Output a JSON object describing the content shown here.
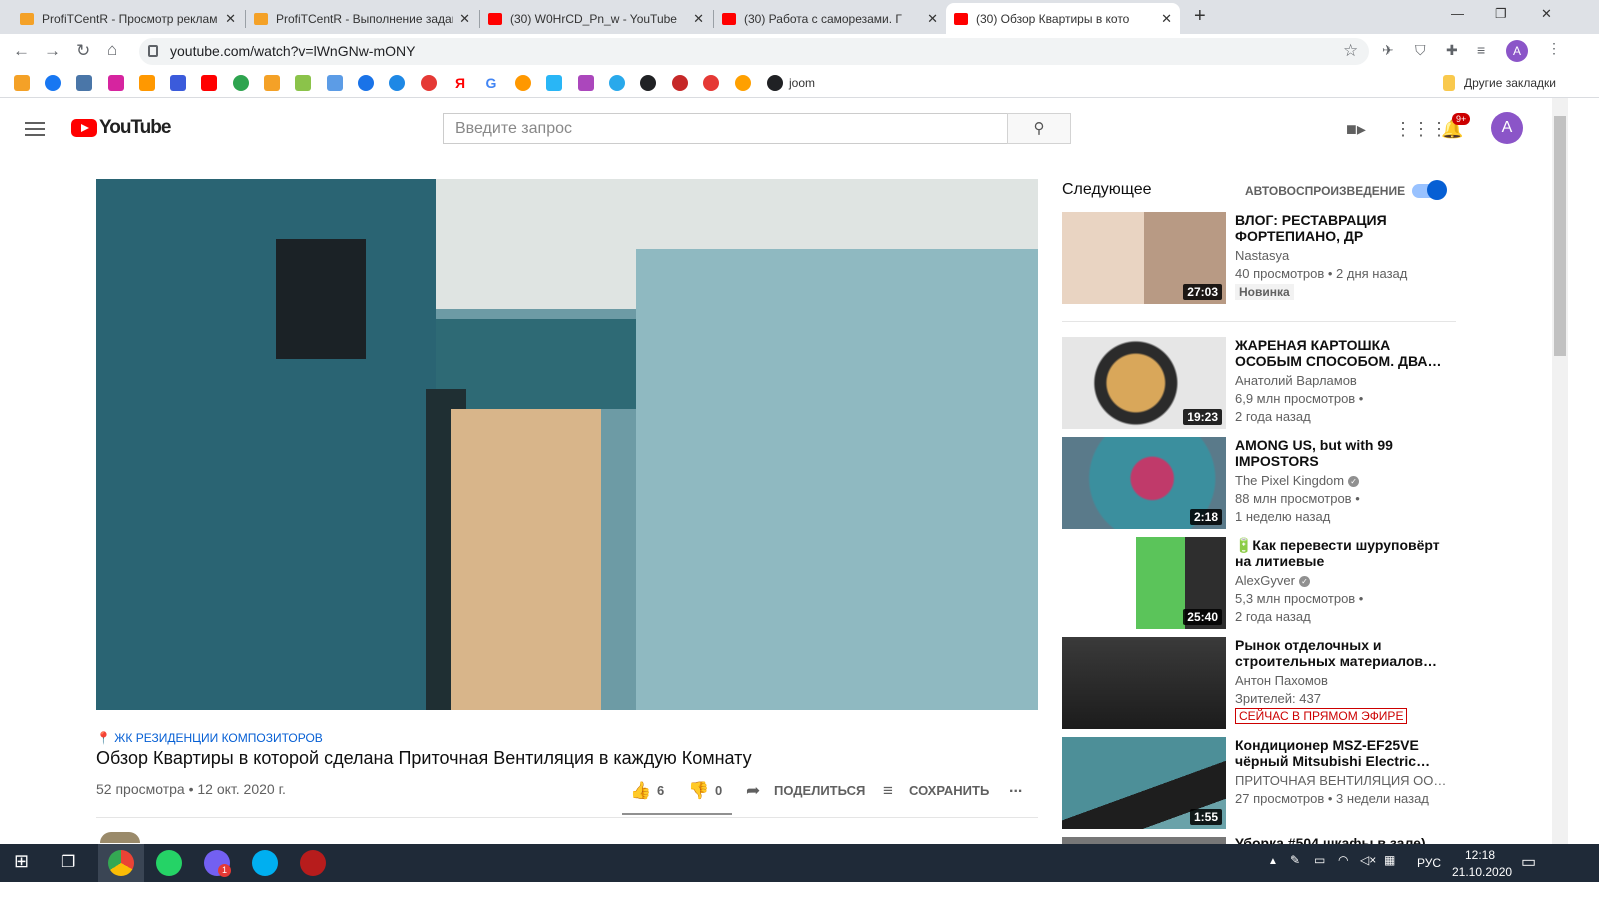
{
  "browser": {
    "tabs": [
      {
        "title": "ProfiTCentR - Просмотр реклам",
        "favicon_color": "#f4a127"
      },
      {
        "title": "ProfiTCentR - Выполнение задан",
        "favicon_color": "#f4a127"
      },
      {
        "title": "(30) W0HrCD_Pn_w - YouTube",
        "favicon_color": "#ff0000"
      },
      {
        "title": "(30) Работа с саморезами. Г",
        "favicon_color": "#ff0000"
      },
      {
        "title": "(30) Обзор Квартиры в кото",
        "favicon_color": "#ff0000"
      }
    ],
    "url": "youtube.com/watch?v=lWnGNw-mONY",
    "profile_initial": "A",
    "bookmarks_other": "Другие закладки",
    "bookmark_joom": "joom"
  },
  "youtube": {
    "logo_text": "YouTube",
    "search_placeholder": "Введите запрос",
    "notifications_count": "9+",
    "avatar_initial": "A"
  },
  "video": {
    "location": "ЖК РЕЗИДЕНЦИИ КОМПОЗИТОРОВ",
    "title": "Обзор Квартиры в которой сделана Приточная Вентиляция в каждую Комнату",
    "meta": "52 просмотра • 12 окт. 2020 г.",
    "likes": "6",
    "dislikes": "0",
    "share_label": "ПОДЕЛИТЬСЯ",
    "save_label": "СОХРАНИТЬ",
    "more_label": "..."
  },
  "sidebar": {
    "title": "Следующее",
    "autoplay_label": "АВТОВОСПРОИЗВЕДЕНИЕ",
    "autoplay_on": true,
    "items": [
      {
        "title": "ВЛОГ: РЕСТАВРАЦИЯ ФОРТЕПИАНО, ДР СВЕКРОВ…",
        "channel": "Nastasya",
        "views": "40 просмотров • 2 дня назад",
        "age": "",
        "badge": "Новинка",
        "duration": "27:03"
      },
      {
        "title": "ЖАРЕНАЯ КАРТОШКА ОСОБЫМ СПОСОБОМ. ДВА…",
        "channel": "Анатолий Варламов",
        "views": "6,9 млн просмотров •",
        "age": "2 года назад",
        "duration": "19:23"
      },
      {
        "title": "AMONG US, but with 99 IMPOSTORS",
        "channel": "The Pixel Kingdom",
        "verified": true,
        "views": "88 млн просмотров •",
        "age": "1 неделю назад",
        "duration": "2:18"
      },
      {
        "title": "🔋Как перевести шуруповёрт на литиевые аккумуляторы,…",
        "channel": "AlexGyver",
        "verified": true,
        "views": "5,3 млн просмотров •",
        "age": "2 года назад",
        "duration": "25:40"
      },
      {
        "title": "Рынок отделочных и строительных материалов…",
        "channel": "Антон Пахомов",
        "views": "Зрителей: 437",
        "live": "СЕЙЧАС В ПРЯМОМ ЭФИРЕ",
        "duration": ""
      },
      {
        "title": "Кондиционер MSZ-EF25VE чёрный Mitsubishi Electric…",
        "channel": "ПРИТОЧНАЯ ВЕНТИЛЯЦИЯ ОО…",
        "views": "27 просмотров • 3 недели назад",
        "age": "",
        "duration": "1:55"
      }
    ],
    "partial_item_title": "Уборка #504 шкафы в зале)"
  },
  "taskbar": {
    "lang": "РУС",
    "time": "12:18",
    "date": "21.10.2020",
    "viber_badge": "1"
  }
}
